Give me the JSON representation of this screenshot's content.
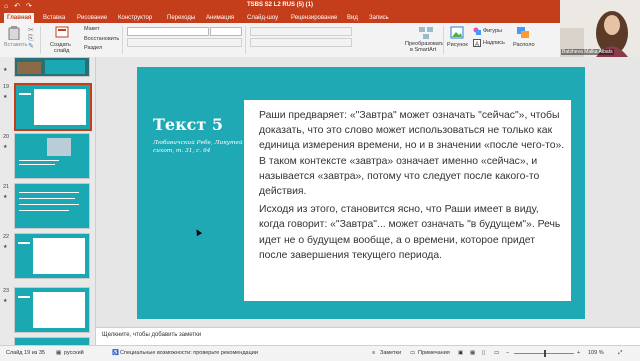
{
  "window": {
    "title": "TSBS S2 L2 RUS (5) (1)",
    "quick_access": "⌂ ↶ ↷"
  },
  "tabs": [
    "Главная",
    "Вставка",
    "Рисование",
    "Конструктор",
    "Переходы",
    "Анимация",
    "Слайд-шоу",
    "Рецензирование",
    "Вид",
    "Запись"
  ],
  "ribbon": {
    "paste": "Вставить",
    "new_slide_1": "Создать",
    "new_slide_2": "слайд",
    "layout": "Макет",
    "reset": "Восстановить",
    "section": "Раздел",
    "convert_1": "Преобразовать",
    "convert_2": "в SmartArt",
    "picture": "Рисунок",
    "shapes": "Фигуры",
    "textbox": "Надпись",
    "arrange": "Располо"
  },
  "video": {
    "name": "Batsheva Malka Albats"
  },
  "thumbnails": [
    {
      "number": "",
      "star": "★"
    },
    {
      "number": "19",
      "star": "★"
    },
    {
      "number": "20",
      "star": "★"
    },
    {
      "number": "21",
      "star": "★"
    },
    {
      "number": "22",
      "star": "★"
    },
    {
      "number": "23",
      "star": "★"
    }
  ],
  "slide": {
    "title": "Текст 5",
    "reference": "Любавичский Ребе, Ликутей сихот, т. 31, с. 64",
    "paragraph1": "Раши предваряет: «\"Завтра\" может означать \"сейчас\"», чтобы доказать, что это слово может использоваться не только как единица измерения времени, но и в значении «после чего-то». В таком контексте «завтра» означает именно «сейчас», и называется «завтра», потому что следует после какого-то действия.",
    "paragraph2": "Исходя из этого, становится ясно, что Раши имеет в виду, когда говорит: «\"Завтра\"... может означать \"в будущем\"». Речь идет не о будущем вообще, а о времени, которое придет после завершения текущего периода."
  },
  "notes": {
    "placeholder": "Щелкните, чтобы добавить заметки"
  },
  "status": {
    "slide": "Слайд 19 из 35",
    "language": "русский",
    "accessibility": "Специальные возможности: проверьте рекомендации",
    "notes": "Заметки",
    "comments": "Примечания",
    "zoom": "109 %"
  },
  "colors": {
    "accent": "#c43e1c",
    "slide_bg": "#1ea9b4"
  }
}
